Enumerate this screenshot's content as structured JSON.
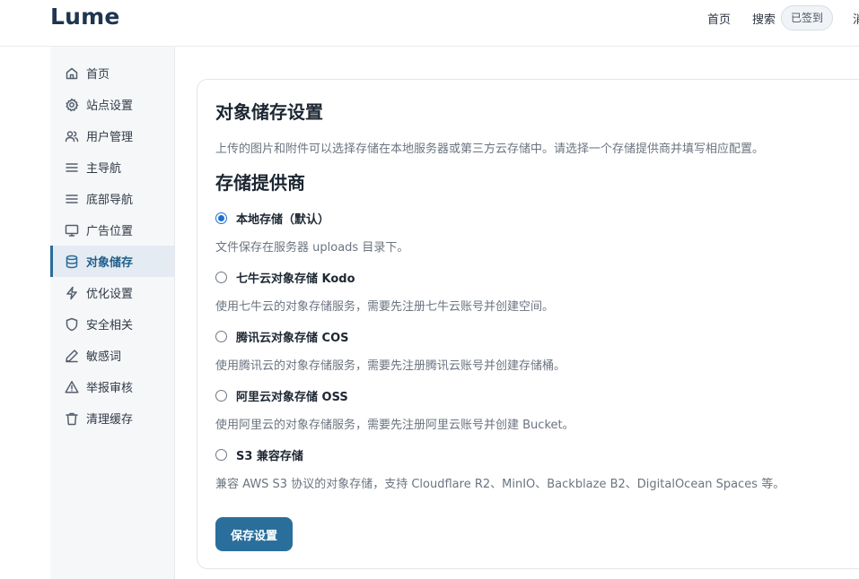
{
  "header": {
    "logo": "Lume",
    "nav": {
      "home": "首页",
      "search": "搜索",
      "checkin": "已签到",
      "more": "消"
    }
  },
  "sidebar": {
    "items": [
      {
        "label": "首页",
        "icon": "home-icon"
      },
      {
        "label": "站点设置",
        "icon": "gear-icon"
      },
      {
        "label": "用户管理",
        "icon": "users-icon"
      },
      {
        "label": "主导航",
        "icon": "menu-icon"
      },
      {
        "label": "底部导航",
        "icon": "menu-icon"
      },
      {
        "label": "广告位置",
        "icon": "monitor-icon"
      },
      {
        "label": "对象储存",
        "icon": "database-icon",
        "active": true
      },
      {
        "label": "优化设置",
        "icon": "lightning-icon"
      },
      {
        "label": "安全相关",
        "icon": "shield-icon"
      },
      {
        "label": "敏感词",
        "icon": "pen-icon"
      },
      {
        "label": "举报审核",
        "icon": "warning-icon"
      },
      {
        "label": "清理缓存",
        "icon": "trash-icon"
      }
    ]
  },
  "main": {
    "title": "对象储存设置",
    "description": "上传的图片和附件可以选择存储在本地服务器或第三方云存储中。请选择一个存储提供商并填写相应配置。",
    "section_title": "存储提供商",
    "options": [
      {
        "label": "本地存储（默认）",
        "desc": "文件保存在服务器 uploads 目录下。",
        "checked": true
      },
      {
        "label": "七牛云对象存储 Kodo",
        "desc": "使用七牛云的对象存储服务，需要先注册七牛云账号并创建空间。",
        "checked": false
      },
      {
        "label": "腾讯云对象存储 COS",
        "desc": "使用腾讯云的对象存储服务，需要先注册腾讯云账号并创建存储桶。",
        "checked": false
      },
      {
        "label": "阿里云对象存储 OSS",
        "desc": "使用阿里云的对象存储服务，需要先注册阿里云账号并创建 Bucket。",
        "checked": false
      },
      {
        "label": "S3 兼容存储",
        "desc": "兼容 AWS S3 协议的对象存储，支持 Cloudflare R2、MinIO、Backblaze B2、DigitalOcean Spaces 等。",
        "checked": false
      }
    ],
    "save_label": "保存设置"
  },
  "colors": {
    "accent": "#2a6f9b",
    "radio_checked": "#1f6fd1",
    "brand": "#1f3550"
  }
}
